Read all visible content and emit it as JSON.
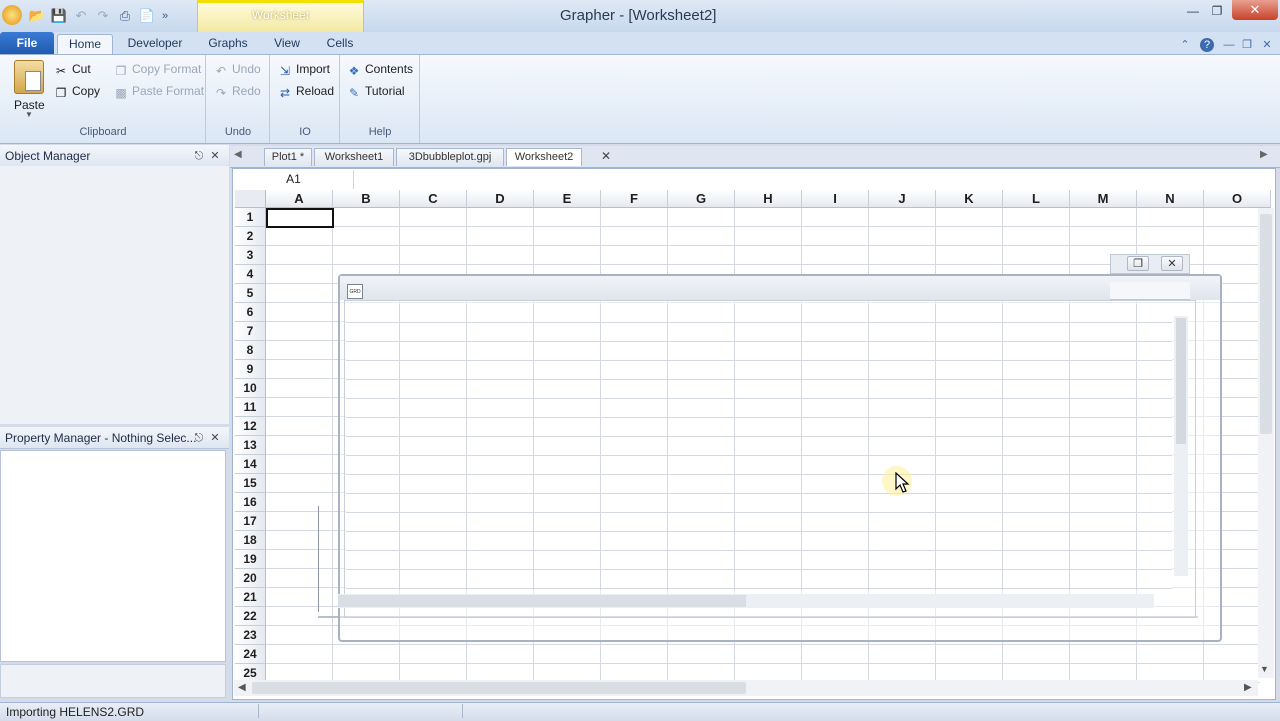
{
  "window": {
    "title": "Grapher - [Worksheet2]",
    "context_tab": "Worksheet",
    "quick_access_overflow": "»"
  },
  "ribbon": {
    "tabs": [
      "File",
      "Home",
      "Developer",
      "Graphs",
      "View",
      "Cells"
    ],
    "groups": {
      "clipboard": {
        "label": "Clipboard",
        "paste": "Paste",
        "cut": "Cut",
        "copy": "Copy",
        "copy_format": "Copy Format",
        "paste_format": "Paste Format"
      },
      "undo": {
        "label": "Undo",
        "undo": "Undo",
        "redo": "Redo"
      },
      "io": {
        "label": "IO",
        "import": "Import",
        "reload": "Reload"
      },
      "help": {
        "label": "Help",
        "contents": "Contents",
        "tutorial": "Tutorial"
      }
    }
  },
  "panels": {
    "object_manager": "Object Manager",
    "property_manager": "Property Manager - Nothing Selec..."
  },
  "document_tabs": [
    "Plot1 *",
    "Worksheet1",
    "3Dbubbleplot.gpj",
    "Worksheet2"
  ],
  "worksheet": {
    "active_cell": "A1",
    "columns": [
      "A",
      "B",
      "C",
      "D",
      "E",
      "F",
      "G",
      "H",
      "I",
      "J",
      "K",
      "L",
      "M",
      "N",
      "O"
    ],
    "rows": [
      "1",
      "2",
      "3",
      "4",
      "5",
      "6",
      "7",
      "8",
      "9",
      "10",
      "11",
      "12",
      "13",
      "14",
      "15",
      "16",
      "17",
      "18",
      "19",
      "20",
      "21",
      "22",
      "23",
      "24",
      "25"
    ]
  },
  "ghost_window": {
    "icon_label": "GRD"
  },
  "statusbar": {
    "message": "Importing HELENS2.GRD"
  },
  "colors": {
    "accent": "#1f5bb0",
    "context_tab": "#f2e000",
    "close": "#c8412a"
  }
}
